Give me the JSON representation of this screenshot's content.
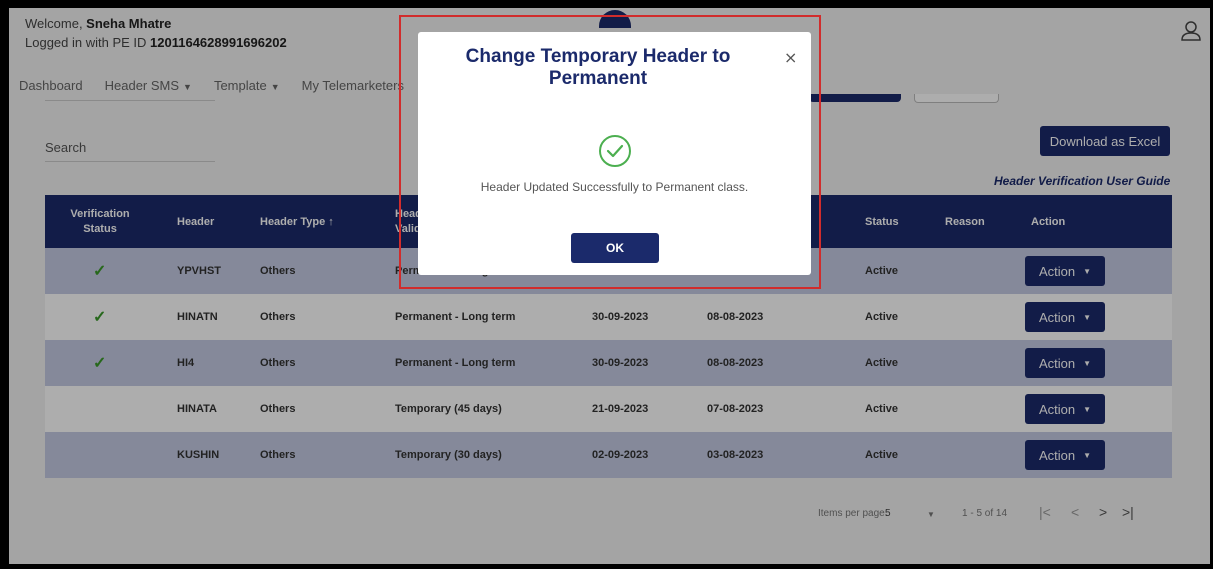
{
  "user": {
    "welcome_prefix": "Welcome, ",
    "name": "Sneha Mhatre",
    "pe_prefix": "Logged in with PE ID ",
    "pe_id": "1201164628991696202"
  },
  "nav": {
    "items": [
      {
        "label": "Dashboard",
        "dropdown": false
      },
      {
        "label": "Header SMS",
        "dropdown": true
      },
      {
        "label": "Template",
        "dropdown": true
      },
      {
        "label": "My Telemarketers",
        "dropdown": false
      }
    ]
  },
  "search": {
    "label": "Search"
  },
  "toolbar": {
    "download_label": "Download as Excel",
    "guide_label": "Header Verification User Guide"
  },
  "table": {
    "columns": [
      {
        "label": "Verification Status"
      },
      {
        "label": "Header"
      },
      {
        "label": "Header Type",
        "sort": "↑"
      },
      {
        "label": "Header Validity"
      },
      {
        "label": "Status"
      },
      {
        "label": "Reason"
      },
      {
        "label": "Action"
      }
    ],
    "rows": [
      {
        "verified": true,
        "header": "YPVHST",
        "type": "Others",
        "validity": "Permanent - Long term",
        "date1": "",
        "date2": "",
        "status": "Active",
        "reason": "",
        "action": "Action"
      },
      {
        "verified": true,
        "header": "HINATN",
        "type": "Others",
        "validity": "Permanent - Long term",
        "date1": "30-09-2023",
        "date2": "08-08-2023",
        "status": "Active",
        "reason": "",
        "action": "Action"
      },
      {
        "verified": true,
        "header": "HI4",
        "type": "Others",
        "validity": "Permanent - Long term",
        "date1": "30-09-2023",
        "date2": "08-08-2023",
        "status": "Active",
        "reason": "",
        "action": "Action"
      },
      {
        "verified": false,
        "header": "HINATA",
        "type": "Others",
        "validity": "Temporary (45 days)",
        "date1": "21-09-2023",
        "date2": "07-08-2023",
        "status": "Active",
        "reason": "",
        "action": "Action"
      },
      {
        "verified": false,
        "header": "KUSHIN",
        "type": "Others",
        "validity": "Temporary (30 days)",
        "date1": "02-09-2023",
        "date2": "03-08-2023",
        "status": "Active",
        "reason": "",
        "action": "Action"
      }
    ]
  },
  "pagination": {
    "items_per_page_label": "Items per page:",
    "items_per_page": "5",
    "range": "1 - 5 of 14"
  },
  "modal": {
    "title": "Change Temporary Header to Permanent",
    "message": "Header Updated Successfully to Permanent class.",
    "ok_label": "OK",
    "close_glyph": "×"
  },
  "colors": {
    "brand": "#1b2a6b",
    "row_shade": "#c5cbe3",
    "success": "#3a9a2a",
    "highlight": "#d12c2c"
  }
}
